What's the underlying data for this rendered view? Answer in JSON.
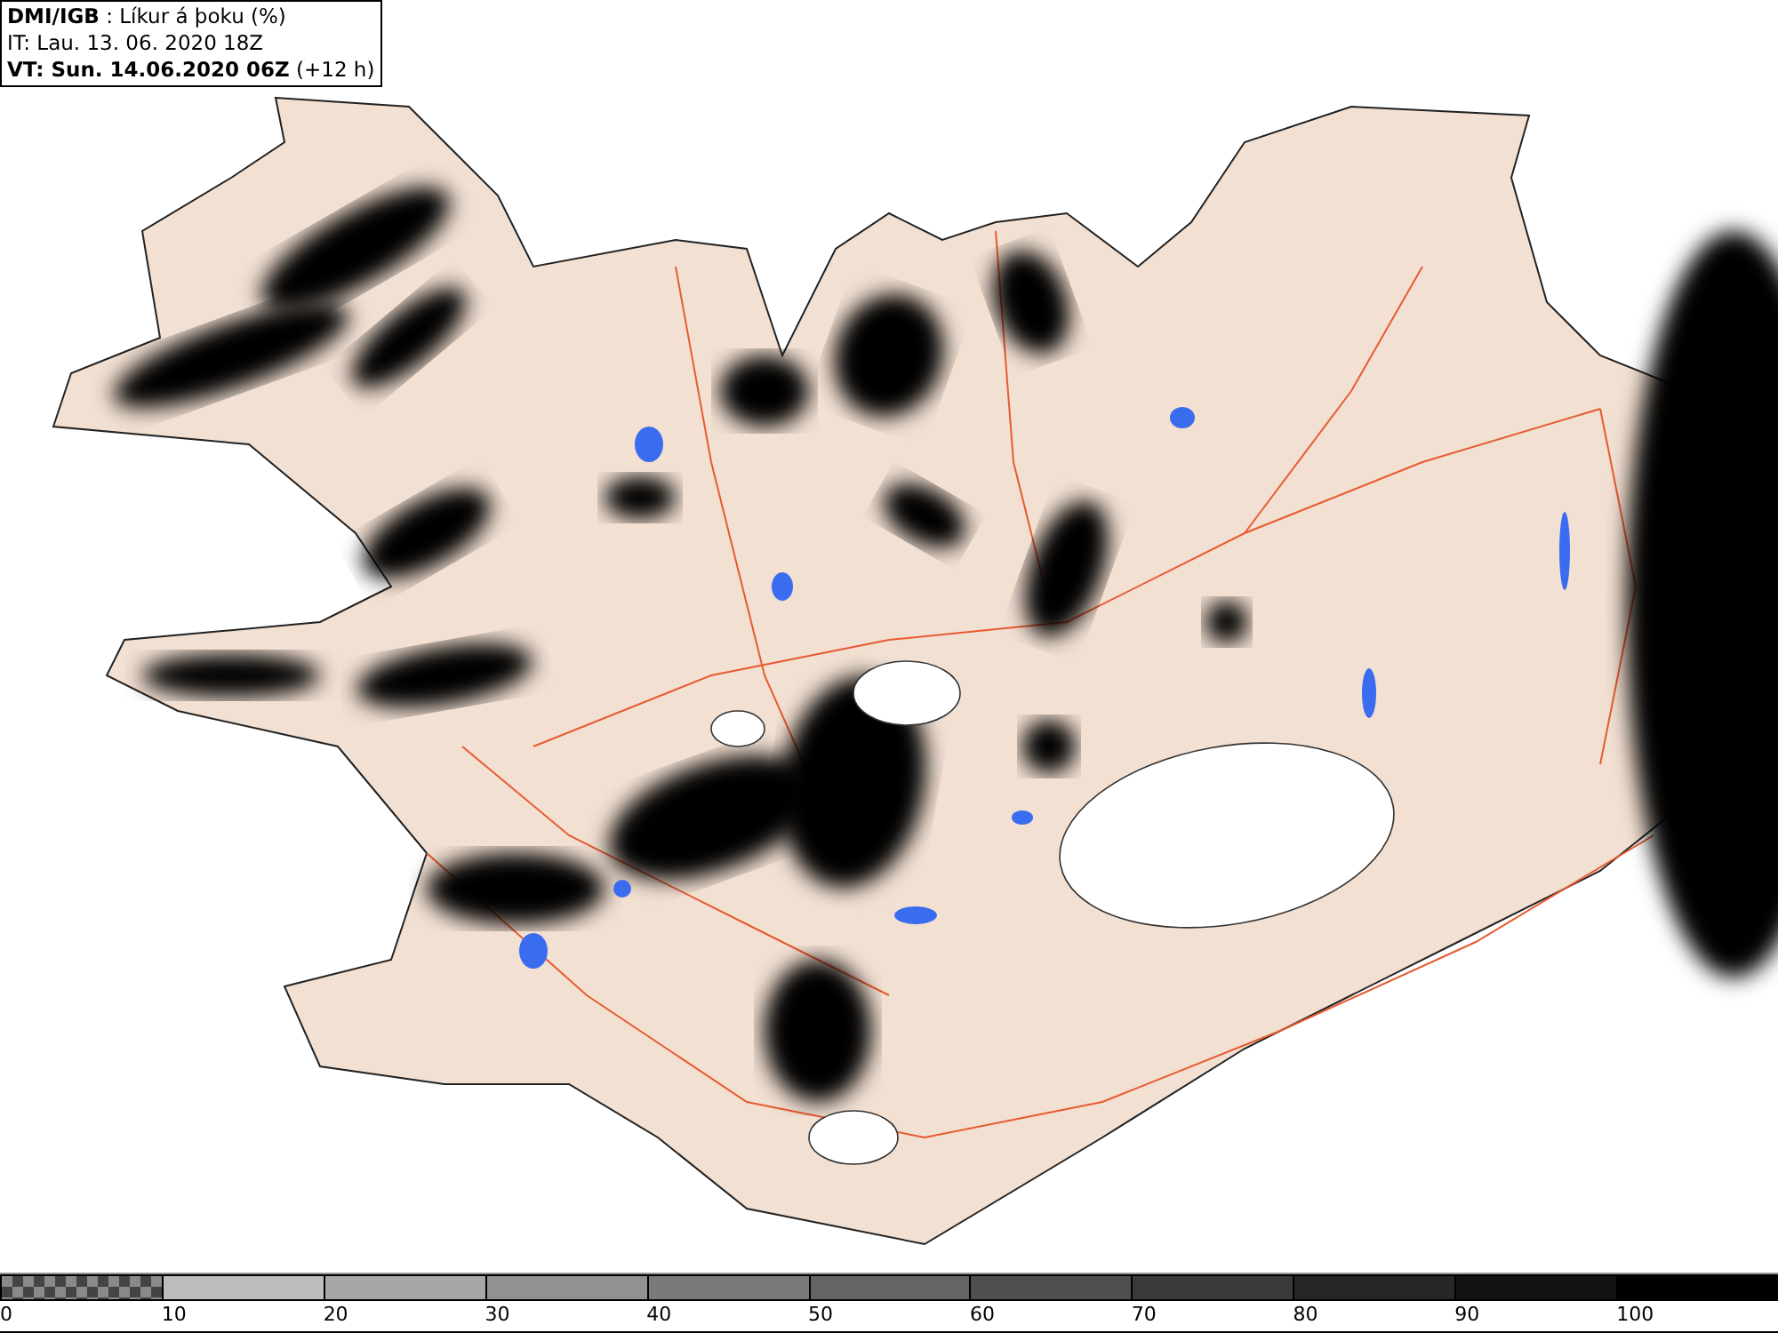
{
  "header": {
    "source": "DMI/IGB",
    "product": ": Líkur á þoku (%)",
    "init_time": "IT: Lau. 13. 06. 2020 18Z",
    "valid_time": "VT: Sun. 14.06.2020 06Z",
    "lead": "(+12 h)"
  },
  "legend": [
    {
      "kind": "checker",
      "color": "#8a8a8a",
      "label": "0"
    },
    {
      "kind": "solid",
      "color": "#bdbdbd",
      "label": "10"
    },
    {
      "kind": "solid",
      "color": "#a7a7a7",
      "label": "20"
    },
    {
      "kind": "solid",
      "color": "#919191",
      "label": "30"
    },
    {
      "kind": "solid",
      "color": "#7a7a7a",
      "label": "40"
    },
    {
      "kind": "solid",
      "color": "#646464",
      "label": "50"
    },
    {
      "kind": "solid",
      "color": "#4f4f4f",
      "label": "60"
    },
    {
      "kind": "solid",
      "color": "#3a3a3a",
      "label": "70"
    },
    {
      "kind": "solid",
      "color": "#262626",
      "label": "80"
    },
    {
      "kind": "solid",
      "color": "#121212",
      "label": "90"
    },
    {
      "kind": "solid",
      "color": "#000000",
      "label": "100"
    }
  ]
}
